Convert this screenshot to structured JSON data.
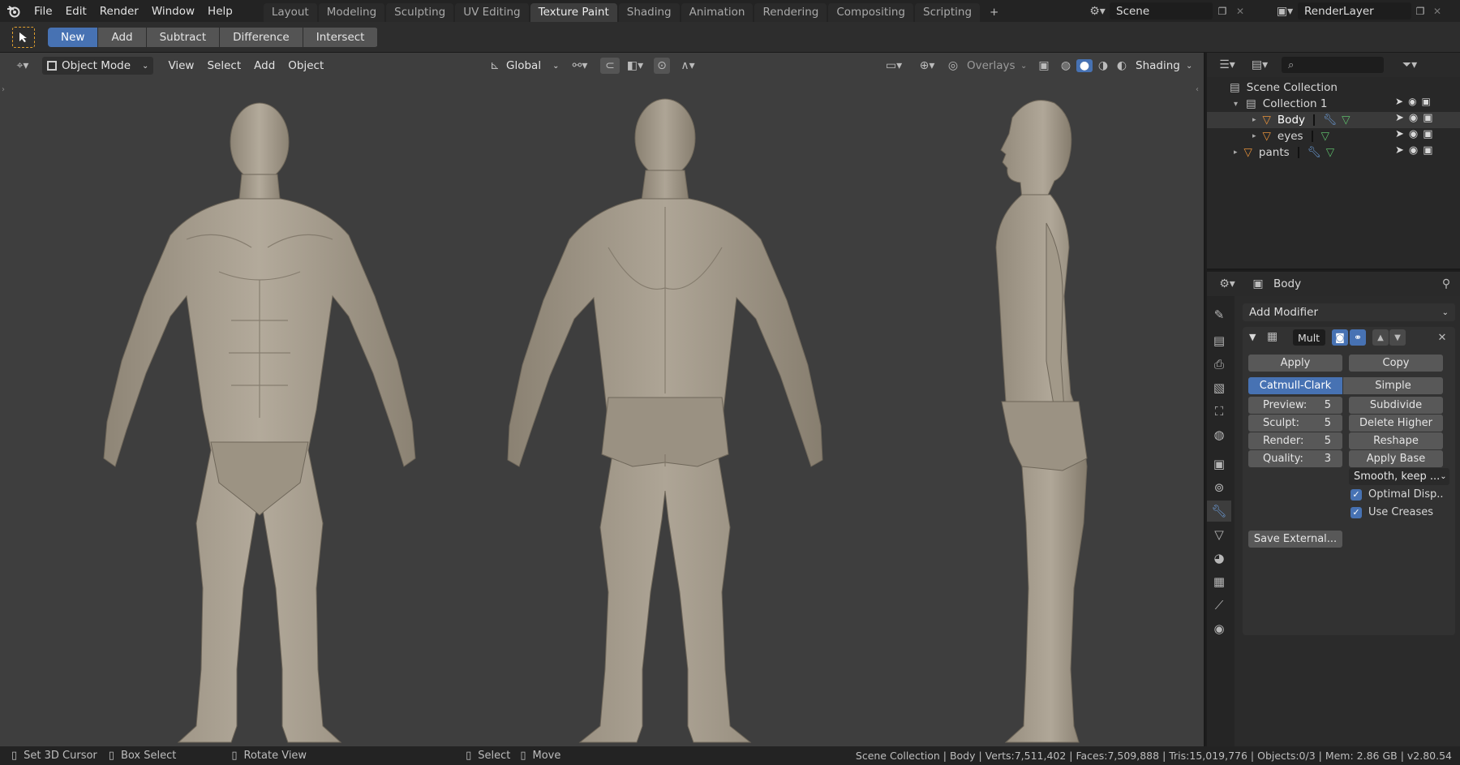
{
  "menu": [
    "File",
    "Edit",
    "Render",
    "Window",
    "Help"
  ],
  "workspaces": {
    "tabs": [
      "Layout",
      "Modeling",
      "Sculpting",
      "UV Editing",
      "Texture Paint",
      "Shading",
      "Animation",
      "Rendering",
      "Compositing",
      "Scripting"
    ],
    "active": "Texture Paint",
    "add_label": "+"
  },
  "scene": {
    "name": "Scene",
    "view_layer": "RenderLayer"
  },
  "toolbar": {
    "modes": [
      "New",
      "Add",
      "Subtract",
      "Difference",
      "Intersect"
    ],
    "active": "New"
  },
  "viewport_header": {
    "mode": "Object Mode",
    "menus": [
      "View",
      "Select",
      "Add",
      "Object"
    ],
    "orientation": "Global",
    "overlays": "Overlays",
    "shading": "Shading"
  },
  "outliner": {
    "root": "Scene Collection",
    "items": [
      {
        "label": "Collection 1"
      },
      {
        "label": "Body"
      },
      {
        "label": "eyes"
      },
      {
        "label": "pants"
      }
    ]
  },
  "properties": {
    "object_name": "Body",
    "add_modifier": "Add Modifier",
    "modifier_name": "Mult",
    "apply": "Apply",
    "copy": "Copy",
    "catmull": "Catmull-Clark",
    "simple": "Simple",
    "levels": [
      {
        "label": "Preview:",
        "value": "5"
      },
      {
        "label": "Sculpt:",
        "value": "5"
      },
      {
        "label": "Render:",
        "value": "5"
      },
      {
        "label": "Quality:",
        "value": "3"
      }
    ],
    "actions": [
      "Subdivide",
      "Delete Higher",
      "Reshape",
      "Apply Base"
    ],
    "uv_smooth": "Smooth, keep ...",
    "optimal_display": "Optimal Disp..",
    "use_creases": "Use Creases",
    "save_external": "Save External..."
  },
  "status": {
    "hints": [
      "Set 3D Cursor",
      "Box Select",
      "Rotate View",
      "Select",
      "Move"
    ],
    "info": "Scene Collection | Body | Verts:7,511,402 | Faces:7,509,888 | Tris:15,019,776 | Objects:0/3 | Mem: 2.86 GB | v2.80.54"
  },
  "colors": {
    "accent": "#4772b3",
    "viewport": "#3e3e3e",
    "mesh": "#a89e8e",
    "object_orange": "#e8923a",
    "modifier_blue": "#6b9bd6"
  }
}
